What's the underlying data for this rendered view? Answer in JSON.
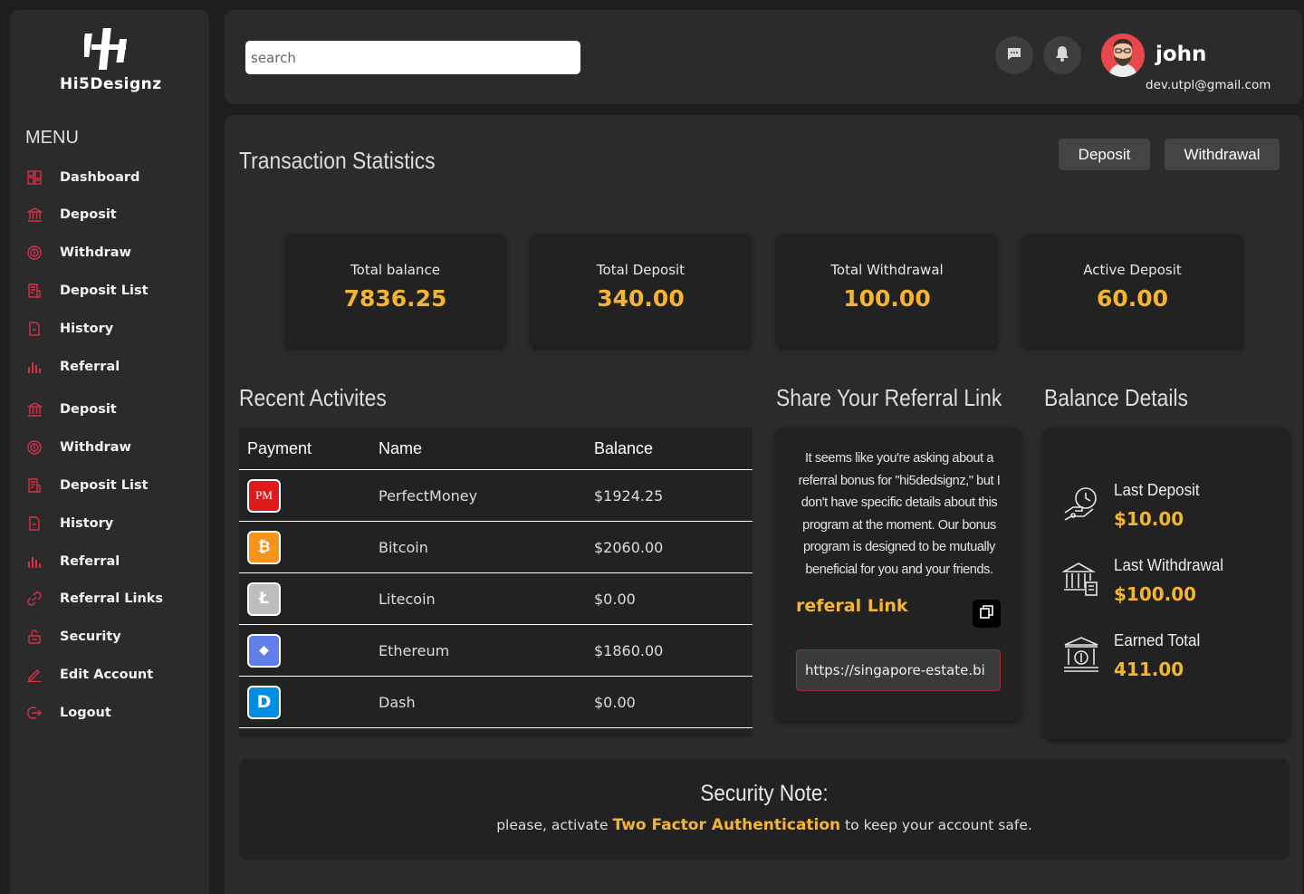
{
  "brand": {
    "name": "Hi5Designz"
  },
  "sidebar": {
    "menu_title": "MENU",
    "items": [
      {
        "label": "Dashboard",
        "icon": "dashboard-icon"
      },
      {
        "label": "Deposit",
        "icon": "bank-icon"
      },
      {
        "label": "Withdraw",
        "icon": "coin-icon"
      },
      {
        "label": "Deposit List",
        "icon": "document-icon"
      },
      {
        "label": "History",
        "icon": "file-icon"
      },
      {
        "label": "Referral",
        "icon": "bar-chart-icon"
      },
      {
        "label": "Deposit",
        "icon": "bank-icon"
      },
      {
        "label": "Withdraw",
        "icon": "coin-icon"
      },
      {
        "label": "Deposit List",
        "icon": "document-icon"
      },
      {
        "label": "History",
        "icon": "file-icon"
      },
      {
        "label": "Referral",
        "icon": "bar-chart-icon"
      },
      {
        "label": "Referral Links",
        "icon": "link-icon"
      },
      {
        "label": "Security",
        "icon": "lock-icon"
      },
      {
        "label": "Edit Account",
        "icon": "pencil-icon"
      },
      {
        "label": "Logout",
        "icon": "logout-icon"
      }
    ]
  },
  "header": {
    "search_placeholder": "search",
    "user": {
      "name": "john",
      "email": "dev.utpl@gmail.com"
    }
  },
  "main": {
    "title": "Transaction Statistics",
    "deposit_button": "Deposit",
    "withdrawal_button": "Withdrawal",
    "stats": [
      {
        "label": "Total balance",
        "value": "7836.25"
      },
      {
        "label": "Total Deposit",
        "value": "340.00"
      },
      {
        "label": "Total Withdrawal",
        "value": "100.00"
      },
      {
        "label": "Active Deposit",
        "value": "60.00"
      }
    ]
  },
  "activities": {
    "title": "Recent Activites",
    "columns": [
      "Payment",
      "Name",
      "Balance"
    ],
    "rows": [
      {
        "icon_text": "PM",
        "name": "PerfectMoney",
        "balance": "$1924.25"
      },
      {
        "icon_text": "₿",
        "name": "Bitcoin",
        "balance": "$2060.00"
      },
      {
        "icon_text": "Ł",
        "name": "Litecoin",
        "balance": "$0.00"
      },
      {
        "icon_text": "◆",
        "name": "Ethereum",
        "balance": "$1860.00"
      },
      {
        "icon_text": "D",
        "name": "Dash",
        "balance": "$0.00"
      }
    ]
  },
  "referral": {
    "title": "Share Your Referral Link",
    "text": "It seems like you're asking about a referral bonus for \"hi5dedsignz,\" but I don't have specific details about this program at the moment. Our bonus program is designed to be mutually beneficial for you and your friends.",
    "label": "referal Link",
    "link": "https://singapore-estate.bi"
  },
  "balance": {
    "title": "Balance Details",
    "items": [
      {
        "label": "Last Deposit",
        "value": "$10.00"
      },
      {
        "label": "Last Withdrawal",
        "value": "$100.00"
      },
      {
        "label": "Earned Total",
        "value": "411.00"
      }
    ]
  },
  "security": {
    "title": "Security Note:",
    "prefix": "please, activate",
    "highlight": "Two Factor Authentication",
    "suffix": "to keep your account safe."
  },
  "colors": {
    "accent": "#f5b532",
    "icon_red": "#d6324a",
    "background": "#1e1e1e",
    "panel": "#2b2b2b"
  }
}
